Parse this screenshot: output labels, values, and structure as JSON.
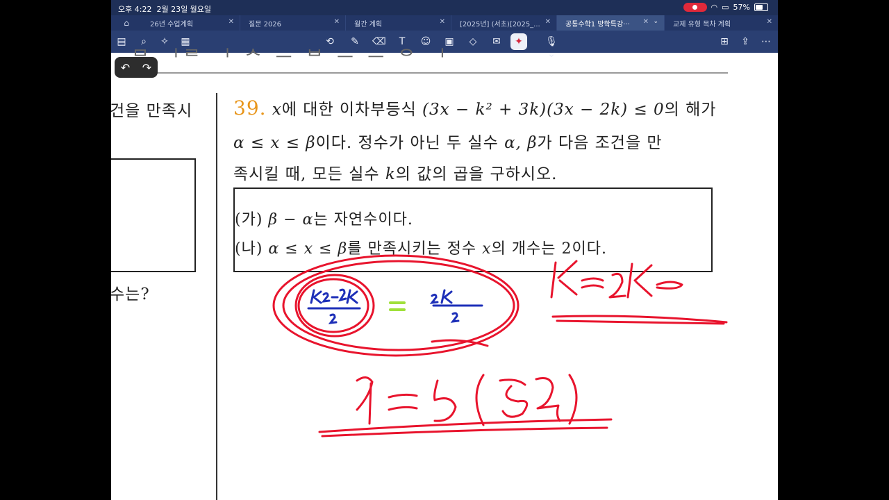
{
  "status_bar": {
    "time": "오후 4:22",
    "date": "2월 23일 월요일",
    "battery": "57%"
  },
  "tabs": [
    {
      "label": "26년 수업계획",
      "active": false
    },
    {
      "label": "질문 2026",
      "active": false
    },
    {
      "label": "월간 계획",
      "active": false
    },
    {
      "label": "[2025년] (서초)[2025_...",
      "active": false
    },
    {
      "label": "공통수학1 방학특강···",
      "active": true
    },
    {
      "label": "교제 유형 목차 계획",
      "active": false
    }
  ],
  "toolbar_icons": [
    "sidebar-icon",
    "search-icon",
    "lasso-icon",
    "bookmark-icon",
    "pen-icon",
    "highlighter-icon",
    "eraser-icon",
    "text-box-icon",
    "shapes-icon",
    "image-icon",
    "sticker-icon",
    "note-icon",
    "laser-pointer-icon",
    "microphone-icon",
    "add-page-icon",
    "share-icon",
    "more-icon"
  ],
  "undo_symbol": "↶",
  "redo_symbol": "↷",
  "left_column": {
    "line1": "건을 만족시",
    "line2": "수는?"
  },
  "question": {
    "number": "39.",
    "line1_var": "x",
    "line1_text": "에 대한 이차부등식",
    "line1_expr": "(3x − k² + 3k)(3x − 2k) ≤ 0",
    "line1_tail": "의 해가",
    "line2_expr": "α ≤ x ≤ β",
    "line2_text": "이다. 정수가 아닌 두 실수",
    "line2_vars": "α, β",
    "line2_tail": "가 다음 조건을 만",
    "line3_text": "족시킬 때, 모든 실수",
    "line3_var": "k",
    "line3_tail": "의 값의 곱을 구하시오."
  },
  "conditions": {
    "a_label": "(가)",
    "a_expr": "β − α",
    "a_text": "는 자연수이다.",
    "b_label": "(나)",
    "b_expr": "α ≤ x ≤ β",
    "b_text": "를 만족시키는 정수",
    "b_var": "x",
    "b_text2": "의 개수는",
    "b_num": "2",
    "b_tail": "이다."
  },
  "colors": {
    "question_number": "#e8961c",
    "ink_red": "#e8142d",
    "ink_blue": "#1d2fb8",
    "ink_green": "#9fe03a"
  }
}
